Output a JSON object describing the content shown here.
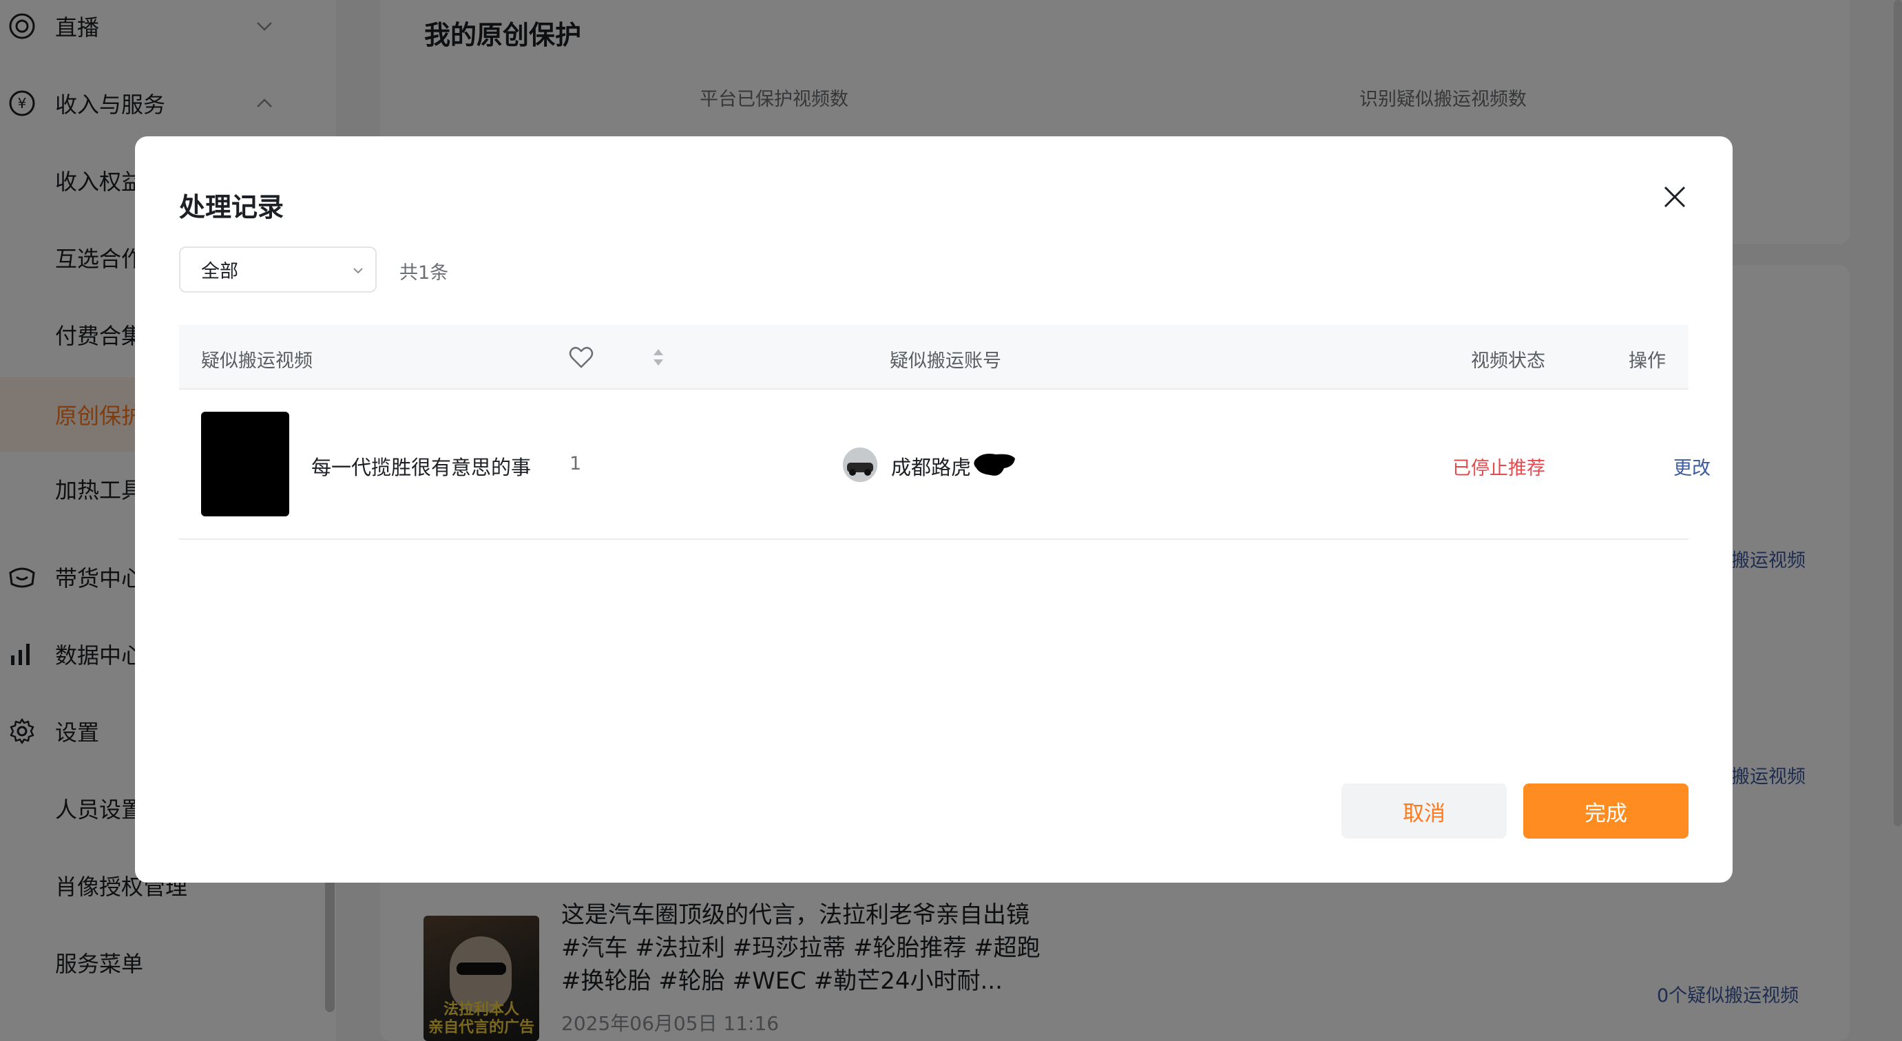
{
  "sidebar": {
    "items": [
      {
        "label": "直播",
        "icon": "live-icon",
        "chevron": "chevron-down"
      },
      {
        "label": "收入与服务",
        "icon": "yen-icon",
        "chevron": "chevron-up"
      },
      {
        "label": "收入权益"
      },
      {
        "label": "互选合作"
      },
      {
        "label": "付费合集"
      },
      {
        "label": "原创保护",
        "active": true
      },
      {
        "label": "加热工具"
      },
      {
        "label": "带货中心",
        "icon": "shop-icon"
      },
      {
        "label": "数据中心",
        "icon": "bar-chart-icon"
      },
      {
        "label": "设置",
        "icon": "gear-icon"
      },
      {
        "label": "人员设置"
      },
      {
        "label": "肖像授权管理"
      },
      {
        "label": "服务菜单"
      }
    ]
  },
  "main": {
    "title": "我的原创保护",
    "stats": {
      "protected_label": "平台已保护视频数",
      "suspected_label": "识别疑似搬运视频数"
    },
    "links": [
      "搬运视频",
      "搬运视频",
      "0个疑似搬运视频"
    ],
    "video": {
      "thumb_caption": "法拉利本人\n亲自代言的广告",
      "title": "这是汽车圈顶级的代言，法拉利老爷亲自出镜 #汽车 #法拉利 #玛莎拉蒂 #轮胎推荐 #超跑 #换轮胎 #轮胎 #WEC #勒芒24小时耐...",
      "date": "2025年06月05日 11:16"
    }
  },
  "modal": {
    "title": "处理记录",
    "filter": {
      "selected": "全部"
    },
    "count": "共1条",
    "columns": {
      "video": "疑似搬运视频",
      "account": "疑似搬运账号",
      "status": "视频状态",
      "action": "操作"
    },
    "rows": [
      {
        "title": "每一代揽胜很有意思的事",
        "likes": "1",
        "account": "成都路虎",
        "status": "已停止推荐",
        "action": "更改"
      }
    ],
    "buttons": {
      "cancel": "取消",
      "done": "完成"
    }
  },
  "colors": {
    "accent": "#fe8c21",
    "status_red": "#e5484d",
    "link_blue": "#3d5a9e"
  }
}
